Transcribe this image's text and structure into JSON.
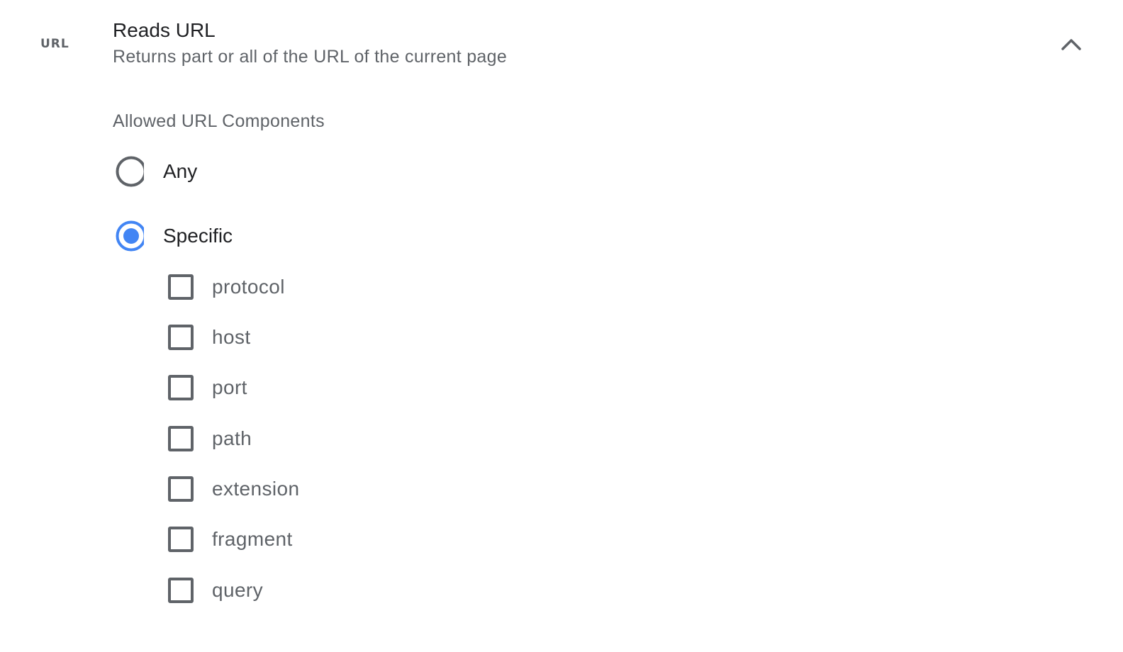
{
  "variable": {
    "badge": "URL",
    "title": "Reads URL",
    "description": "Returns part or all of the URL of the current page",
    "expanded": true
  },
  "allowed_components": {
    "label": "Allowed URL Components",
    "options": [
      {
        "label": "Any",
        "selected": false
      },
      {
        "label": "Specific",
        "selected": true
      }
    ],
    "components": [
      {
        "label": "protocol",
        "checked": false
      },
      {
        "label": "host",
        "checked": false
      },
      {
        "label": "port",
        "checked": false
      },
      {
        "label": "path",
        "checked": false
      },
      {
        "label": "extension",
        "checked": false
      },
      {
        "label": "fragment",
        "checked": false
      },
      {
        "label": "query",
        "checked": false
      }
    ]
  },
  "colors": {
    "accent": "#4285f4",
    "text_primary": "#202124",
    "text_secondary": "#5f6368"
  },
  "icons": {
    "collapse": "chevron-up-icon"
  }
}
